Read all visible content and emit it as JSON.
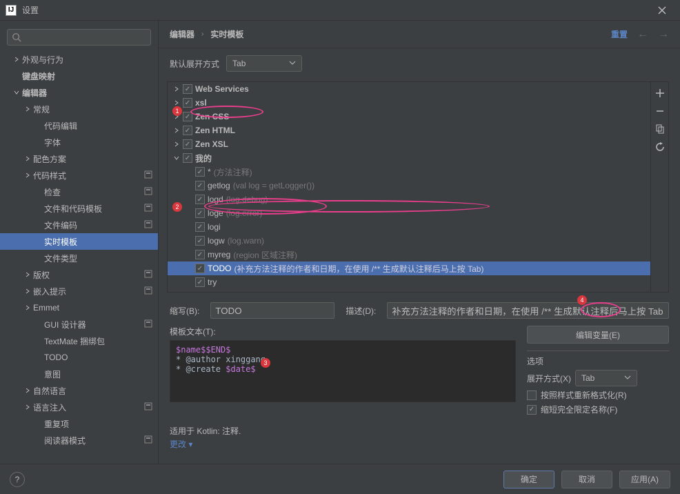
{
  "title": "设置",
  "breadcrumb": {
    "a": "编辑器",
    "b": "实时模板",
    "reset": "重置"
  },
  "expand": {
    "label": "默认展开方式",
    "value": "Tab"
  },
  "sidebar": {
    "items": [
      {
        "label": "外观与行为",
        "arrow": "right",
        "indent": 0
      },
      {
        "label": "键盘映射",
        "indent": 0,
        "bold": true
      },
      {
        "label": "编辑器",
        "arrow": "down",
        "indent": 0,
        "bold": true
      },
      {
        "label": "常规",
        "arrow": "right",
        "indent": 1
      },
      {
        "label": "代码编辑",
        "indent": 2
      },
      {
        "label": "字体",
        "indent": 2
      },
      {
        "label": "配色方案",
        "arrow": "right",
        "indent": 1
      },
      {
        "label": "代码样式",
        "arrow": "right",
        "indent": 1,
        "proj": true
      },
      {
        "label": "检查",
        "indent": 2,
        "proj": true
      },
      {
        "label": "文件和代码模板",
        "indent": 2,
        "proj": true
      },
      {
        "label": "文件编码",
        "indent": 2,
        "proj": true
      },
      {
        "label": "实时模板",
        "indent": 2,
        "selected": true
      },
      {
        "label": "文件类型",
        "indent": 2
      },
      {
        "label": "版权",
        "arrow": "right",
        "indent": 1,
        "proj": true
      },
      {
        "label": "嵌入提示",
        "arrow": "right",
        "indent": 1,
        "proj": true
      },
      {
        "label": "Emmet",
        "arrow": "right",
        "indent": 1
      },
      {
        "label": "GUI 设计器",
        "indent": 2,
        "proj": true
      },
      {
        "label": "TextMate 捆绑包",
        "indent": 2
      },
      {
        "label": "TODO",
        "indent": 2
      },
      {
        "label": "意图",
        "indent": 2
      },
      {
        "label": "自然语言",
        "arrow": "right",
        "indent": 1
      },
      {
        "label": "语言注入",
        "arrow": "right",
        "indent": 1,
        "proj": true
      },
      {
        "label": "重复项",
        "indent": 2
      },
      {
        "label": "阅读器模式",
        "indent": 2,
        "proj": true
      }
    ]
  },
  "groups": [
    {
      "name": "Web Services",
      "arrow": "right"
    },
    {
      "name": "xsl",
      "arrow": "right"
    },
    {
      "name": "Zen CSS",
      "arrow": "right"
    },
    {
      "name": "Zen HTML",
      "arrow": "right"
    },
    {
      "name": "Zen XSL",
      "arrow": "right"
    },
    {
      "name": "我的",
      "arrow": "down"
    }
  ],
  "mine": [
    {
      "abbr": "*",
      "desc": "(方法注释)"
    },
    {
      "abbr": "getlog",
      "desc": "(val log = getLogger())"
    },
    {
      "abbr": "logd",
      "desc": "(log.debug)"
    },
    {
      "abbr": "loge",
      "desc": "(log.error)"
    },
    {
      "abbr": "logi",
      "desc": ""
    },
    {
      "abbr": "logw",
      "desc": "(log.warn)"
    },
    {
      "abbr": "myreg",
      "desc": "(region 区域注释)"
    },
    {
      "abbr": "TODO",
      "desc": "(补充方法注释的作者和日期，在使用 /** 生成默认注释后马上按 Tab)",
      "selected": true
    },
    {
      "abbr": "try",
      "desc": ""
    }
  ],
  "form": {
    "abbr_label": "缩写(B):",
    "abbr_value": "TODO",
    "desc_label": "描述(D):",
    "desc_value": "补充方法注释的作者和日期，在使用 /** 生成默认注释后马上按 Tab",
    "text_label": "模板文本(T):",
    "edit_vars": "编辑变量(E)"
  },
  "template_text": {
    "l1a": "$name$",
    "l1b": "$END$",
    "l2": "* @author xinggang",
    "l3a": "* @create ",
    "l3b": "$date$"
  },
  "options": {
    "title": "选项",
    "expand_label": "展开方式(X)",
    "expand_value": "Tab",
    "reformat": "按照样式重新格式化(R)",
    "shorten": "缩短完全限定名称(F)"
  },
  "applies": {
    "text": "适用于 Kotlin: 注释.",
    "change": "更改"
  },
  "buttons": {
    "ok": "确定",
    "cancel": "取消",
    "apply": "应用(A)"
  }
}
